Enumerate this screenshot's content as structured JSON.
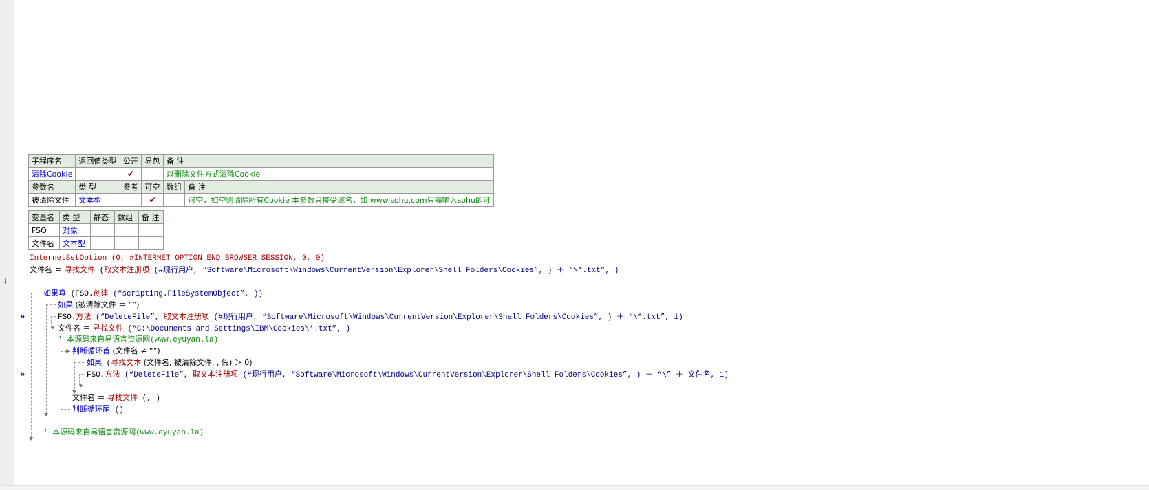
{
  "sub_table": {
    "headers": [
      "子程序名",
      "返回值类型",
      "公开",
      "易包",
      "备 注"
    ],
    "row": {
      "name": "清除Cookie",
      "return_type": "",
      "public_check": "✔",
      "easy_pkg": "",
      "note": "以删除文件方式清除Cookie"
    }
  },
  "param_table": {
    "headers": [
      "参数名",
      "类 型",
      "参考",
      "可空",
      "数组",
      "备 注"
    ],
    "row": {
      "name": "被清除文件",
      "type": "文本型",
      "ref": "",
      "nullable_check": "✔",
      "array": "",
      "note": "可空，如空则清除所有Cookie 本参数只接受域名，如 www.sohu.com只需输入sohu即可"
    }
  },
  "var_table": {
    "headers": [
      "变量名",
      "类 型",
      "静态",
      "数组",
      "备 注"
    ],
    "rows": [
      {
        "name": "FSO",
        "type": "对象"
      },
      {
        "name": "文件名",
        "type": "文本型"
      }
    ]
  },
  "code": {
    "l1": "InternetSetOption (0, #INTERNET_OPTION_END_BROWSER_SESSION, 0, 0)",
    "l2a": "文件名 ＝ ",
    "l2b": "寻找文件",
    "l2c": " (",
    "l2d": "取文本注册项",
    "l2e": " (#现行用户, “Software\\Microsoft\\Windows\\CurrentVersion\\Explorer\\Shell Folders\\Cookies”, ) ＋ “\\*.txt”, )",
    "l3a": "如果真",
    "l3b": " (FSO.",
    "l3c": "创建",
    "l3d": " (“scripting.FileSystemObject”, ))",
    "l4a": "如果",
    "l4b": " (被清除文件 ＝ “”)",
    "l5a": "FSO.",
    "l5b": "方法",
    "l5c": " (“DeleteFile”, ",
    "l5d": "取文本注册项",
    "l5e": " (#现行用户, “Software\\Microsoft\\Windows\\CurrentVersion\\Explorer\\Shell Folders\\Cookies”, ) ＋ “\\*.txt”, 1)",
    "l6a": "文件名 ＝ ",
    "l6b": "寻找文件",
    "l6c": " (“C:\\Documents and Settings\\IBM\\Cookies\\*.txt”, )",
    "l7": "' 本源码来自易语言资源网(www.eyuyan.la)",
    "l8a": "判断循环首",
    "l8b": " (文件名 ≠ “”)",
    "l9a": "如果",
    "l9b": " (",
    "l9c": "寻找文本",
    "l9d": " (文件名, 被清除文件, , 假) ＞ 0)",
    "l10a": "FSO.",
    "l10b": "方法",
    "l10c": " (“DeleteFile”, ",
    "l10d": "取文本注册项",
    "l10e": " (#现行用户, “Software\\Microsoft\\Windows\\CurrentVersion\\Explorer\\Shell Folders\\Cookies”, ) ＋ “\\” ＋ 文件名, 1)",
    "l11a": "文件名 ＝ ",
    "l11b": "寻找文件",
    "l11c": " (, )",
    "l12a": "判断循环尾",
    "l12b": " ()",
    "l13": "' 本源码来自易语言资源网(www.eyuyan.la)"
  },
  "gutter": {
    "cursor_arrow": "↓",
    "breakpoint_marks": [
      "»",
      "»"
    ]
  }
}
